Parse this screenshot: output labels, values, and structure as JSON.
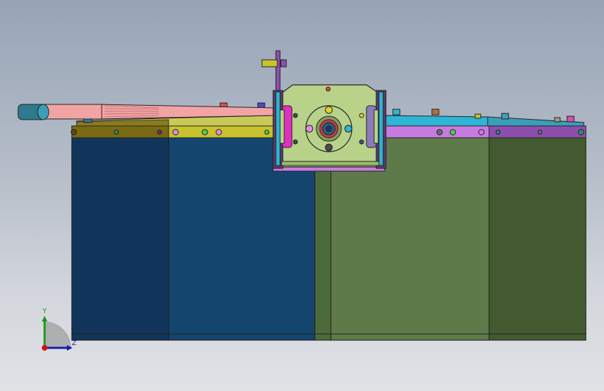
{
  "viewport": {
    "background_top": "#97a4b6",
    "background_bottom": "#e0e2e6"
  },
  "triad": {
    "y_label": "Y",
    "z_label": "Z",
    "y_color": "#1a9a1a",
    "z_color": "#1a1aa0",
    "origin_color": "#d01010"
  },
  "model": {
    "panels": [
      {
        "name": "panel-dark-navy",
        "color": "#11355a"
      },
      {
        "name": "panel-blue",
        "color": "#14456f"
      },
      {
        "name": "panel-olive-narrow",
        "color": "#4d6b3a"
      },
      {
        "name": "panel-green",
        "color": "#5e7a48"
      },
      {
        "name": "panel-dark-green",
        "color": "#435a30"
      }
    ],
    "rail_colors": [
      "#7a6a14",
      "#c7c22e",
      "#c77be0",
      "#2eb4d4",
      "#8c4fae"
    ],
    "gearbox_plate": "#b8d28a",
    "tube_color": "#f2a3a3",
    "tube_end": "#2c7a8c"
  }
}
